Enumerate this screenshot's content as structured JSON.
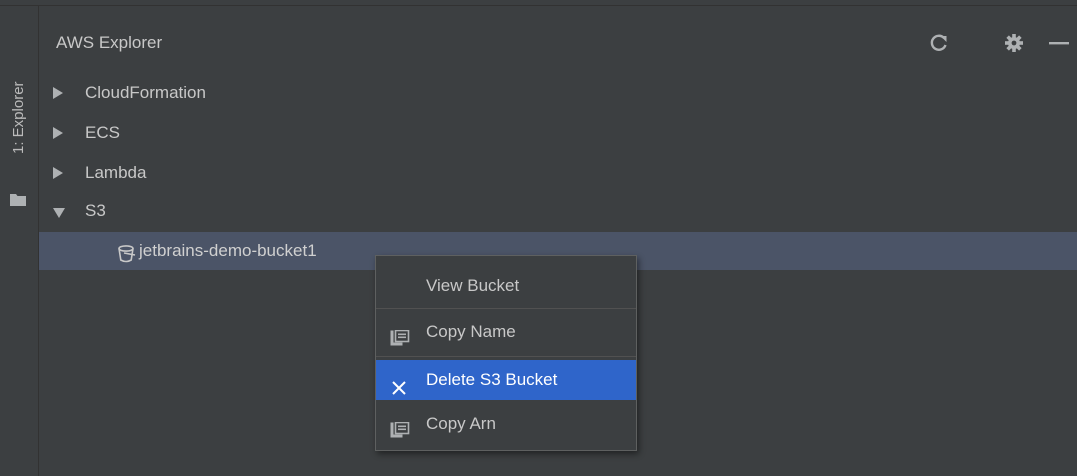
{
  "stripe": {
    "tab_label": "1: Explorer"
  },
  "panel": {
    "title": "AWS Explorer",
    "icons": [
      "refresh-icon",
      "gear-icon",
      "minimize-icon"
    ]
  },
  "tree": {
    "items": [
      {
        "label": "CloudFormation",
        "expanded": false
      },
      {
        "label": "ECS",
        "expanded": false
      },
      {
        "label": "Lambda",
        "expanded": false
      },
      {
        "label": "S3",
        "expanded": true
      }
    ],
    "bucket": {
      "label": "jetbrains-demo-bucket1",
      "icon": "bucket-icon"
    }
  },
  "context_menu": {
    "items": [
      {
        "label": "View Bucket",
        "icon": ""
      },
      {
        "label": "Copy Name",
        "icon": "copy-icon"
      },
      {
        "label": "Delete S3 Bucket",
        "icon": "close-icon",
        "active": true
      },
      {
        "label": "Copy Arn",
        "icon": "copy-icon"
      }
    ]
  },
  "colors": {
    "background": "#3c3f41",
    "selection": "#4b5467",
    "menu_highlight": "#2f65ca",
    "text": "#c8c8c8"
  }
}
